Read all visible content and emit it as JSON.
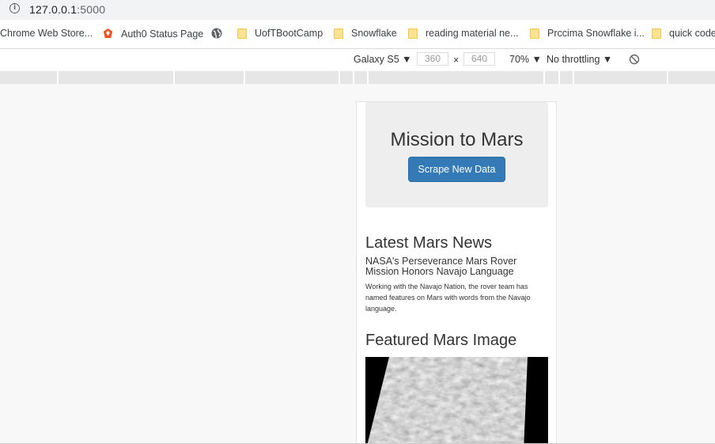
{
  "browser": {
    "url_host": "127.0.0.1",
    "url_port": ":5000",
    "bookmarks": [
      {
        "label": "Chrome Web Store...",
        "icon": "none"
      },
      {
        "label": "Auth0 Status Page",
        "icon": "auth0-icon"
      },
      {
        "label": "",
        "icon": "globe-icon"
      },
      {
        "label": "UofTBootCamp",
        "icon": "folder-icon"
      },
      {
        "label": "Snowflake",
        "icon": "folder-icon"
      },
      {
        "label": "reading material ne...",
        "icon": "folder-icon"
      },
      {
        "label": "Prccima Snowflake i...",
        "icon": "folder-icon"
      },
      {
        "label": "quick code",
        "icon": "folder-icon"
      }
    ]
  },
  "devtools": {
    "device": "Galaxy S5 ▼",
    "width": "360",
    "times": "×",
    "height": "640",
    "zoom": "70% ▼",
    "throttling": "No throttling ▼"
  },
  "page": {
    "title": "Mission to Mars",
    "scrape_button": "Scrape New Data",
    "news_heading": "Latest Mars News",
    "news_title": "NASA's Perseverance Mars Rover Mission Honors Navajo Language",
    "news_paragraph": "Working with the Navajo Nation, the rover team has named features on Mars with words from the Navajo language.",
    "image_heading": "Featured Mars Image"
  },
  "colors": {
    "button": "#337ab7",
    "jumbotron": "#eeeeee"
  }
}
